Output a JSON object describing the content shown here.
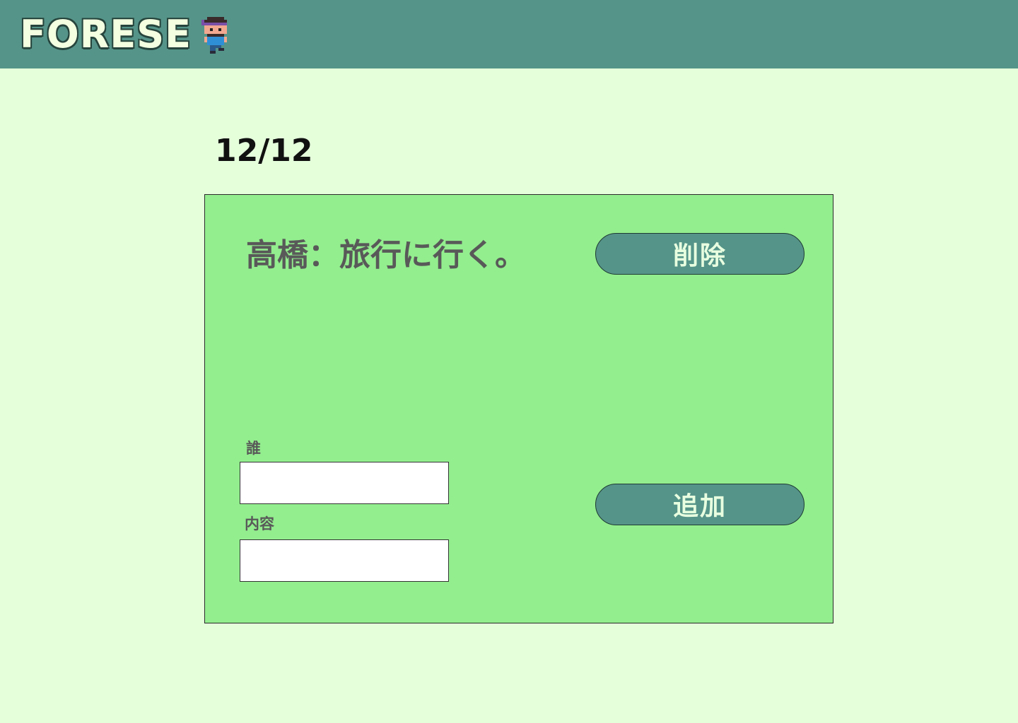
{
  "header": {
    "logo": "FORESE",
    "mascot_icon": "pixel-character-icon",
    "background": "#559489"
  },
  "main": {
    "date": "12/12"
  },
  "card": {
    "entry_text": "高橋：旅行に行く。",
    "delete_label": "削除",
    "add_label": "追加",
    "who_label": "誰",
    "who_value": "",
    "content_label": "内容",
    "content_value": "",
    "background": "#93ee8e"
  }
}
